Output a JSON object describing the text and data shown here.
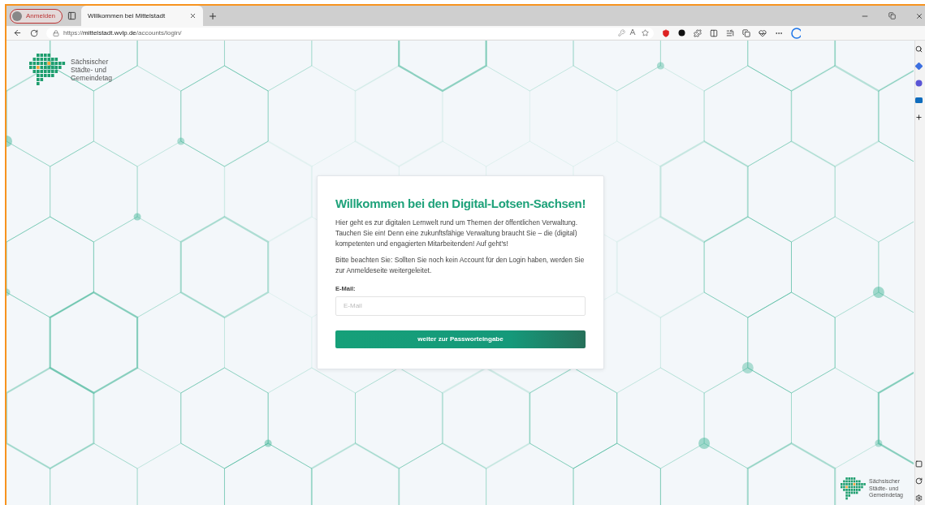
{
  "browser": {
    "profile_button": "Anmelden",
    "tabs": [
      {
        "title": "Willkommen bei Mittelstadt",
        "selected": true
      }
    ],
    "url": "https://**mittelstadt.wvlp.de**/accounts/login/"
  },
  "logo": {
    "lines": [
      "Sächsischer",
      "Städte- und",
      "Gemeindetag"
    ]
  },
  "card": {
    "title": "Willkommen bei den Digital-Lotsen-Sachsen!",
    "paragraphs": [
      "Hier geht es zur digitalen Lernwelt rund um Themen der öffentlichen Verwaltung. Tauchen Sie ein! Denn eine zukunftsfähige Verwaltung braucht Sie – die (digital) kompetenten und engagierten Mitarbeitenden! Auf geht's!",
      "Bitte beachten Sie: Sollten Sie noch kein Account für den Login haben, werden Sie zur Anmeldeseite weitergeleitet."
    ],
    "email_label": "E-Mail:",
    "email_placeholder": "E-Mail",
    "submit_button": "weiter zur Passworteingabe"
  },
  "footer_logo": {
    "lines": [
      "Sächsischer",
      "Städte- und",
      "Gemeindetag"
    ]
  }
}
